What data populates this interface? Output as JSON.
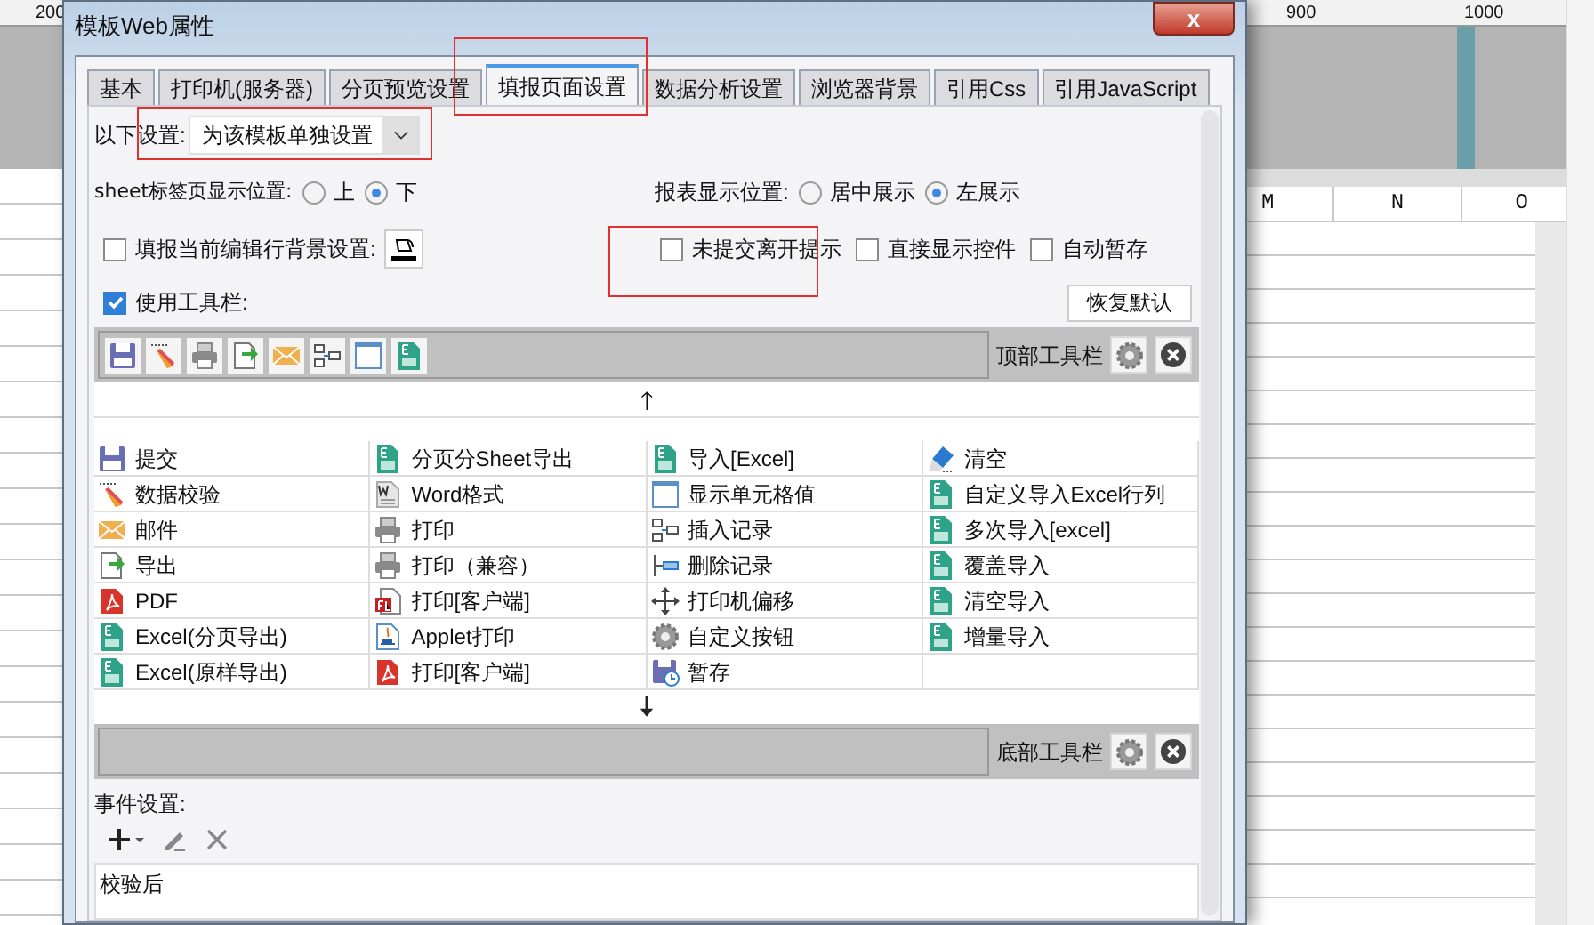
{
  "background": {
    "ruler_labels": [
      "200",
      "900",
      "1000"
    ],
    "column_headers": [
      "M",
      "N",
      "O"
    ]
  },
  "window": {
    "title": "模板Web属性",
    "close": "x"
  },
  "tabs": [
    {
      "label": "基本",
      "selected": false
    },
    {
      "label": "打印机(服务器)",
      "selected": false
    },
    {
      "label": "分页预览设置",
      "selected": false
    },
    {
      "label": "填报页面设置",
      "selected": true
    },
    {
      "label": "数据分析设置",
      "selected": false
    },
    {
      "label": "浏览器背景",
      "selected": false
    },
    {
      "label": "引用Css",
      "selected": false
    },
    {
      "label": "引用JavaScript",
      "selected": false
    }
  ],
  "settings_scope": {
    "label": "以下设置:",
    "value": "为该模板单独设置"
  },
  "sheet_tab_position": {
    "label": "sheet标签页显示位置:",
    "options": [
      {
        "label": "上",
        "selected": false
      },
      {
        "label": "下",
        "selected": true
      }
    ]
  },
  "report_position": {
    "label": "报表显示位置:",
    "options": [
      {
        "label": "居中展示",
        "selected": false
      },
      {
        "label": "左展示",
        "selected": true
      }
    ]
  },
  "row_background": {
    "label": "填报当前编辑行背景设置:",
    "checked": false
  },
  "options": [
    {
      "label": "未提交离开提示",
      "checked": false
    },
    {
      "label": "直接显示控件",
      "checked": false
    },
    {
      "label": "自动暂存",
      "checked": false
    }
  ],
  "use_toolbar": {
    "label": "使用工具栏:",
    "checked": true
  },
  "restore_button": "恢复默认",
  "top_toolbar": {
    "label": "顶部工具栏",
    "icons": [
      {
        "kind": "save"
      },
      {
        "kind": "pencil"
      },
      {
        "kind": "print"
      },
      {
        "kind": "export"
      },
      {
        "kind": "mail"
      },
      {
        "kind": "insert"
      },
      {
        "kind": "cell"
      },
      {
        "kind": "excel"
      }
    ]
  },
  "up_arrow": "🡑",
  "button_columns": [
    [
      {
        "label": "提交",
        "kind": "save"
      },
      {
        "label": "数据校验",
        "kind": "pencil"
      },
      {
        "label": "邮件",
        "kind": "mail"
      },
      {
        "label": "导出",
        "kind": "export"
      },
      {
        "label": "PDF",
        "kind": "pdf"
      },
      {
        "label": "Excel(分页导出)",
        "kind": "excel"
      },
      {
        "label": "Excel(原样导出)",
        "kind": "excel"
      }
    ],
    [
      {
        "label": "分页分Sheet导出",
        "kind": "excel"
      },
      {
        "label": "Word格式",
        "kind": "word"
      },
      {
        "label": "打印",
        "kind": "print"
      },
      {
        "label": "打印（兼容）",
        "kind": "print"
      },
      {
        "label": "打印[客户端]",
        "kind": "flash"
      },
      {
        "label": "Applet打印",
        "kind": "applet"
      },
      {
        "label": "打印[客户端]",
        "kind": "pdf"
      }
    ],
    [
      {
        "label": "导入[Excel]",
        "kind": "excel"
      },
      {
        "label": "显示单元格值",
        "kind": "cell"
      },
      {
        "label": "插入记录",
        "kind": "insert"
      },
      {
        "label": "删除记录",
        "kind": "delete"
      },
      {
        "label": "打印机偏移",
        "kind": "move"
      },
      {
        "label": "自定义按钮",
        "kind": "gear"
      },
      {
        "label": "暂存",
        "kind": "stash"
      }
    ],
    [
      {
        "label": "清空",
        "kind": "eraser"
      },
      {
        "label": "自定义导入Excel行列",
        "kind": "excel"
      },
      {
        "label": "多次导入[excel]",
        "kind": "excel"
      },
      {
        "label": "覆盖导入",
        "kind": "excel"
      },
      {
        "label": "清空导入",
        "kind": "excel"
      },
      {
        "label": "增量导入",
        "kind": "excel"
      }
    ]
  ],
  "bottom_toolbar": {
    "label": "底部工具栏"
  },
  "events": {
    "label": "事件设置:",
    "items": [
      "校验后"
    ]
  }
}
